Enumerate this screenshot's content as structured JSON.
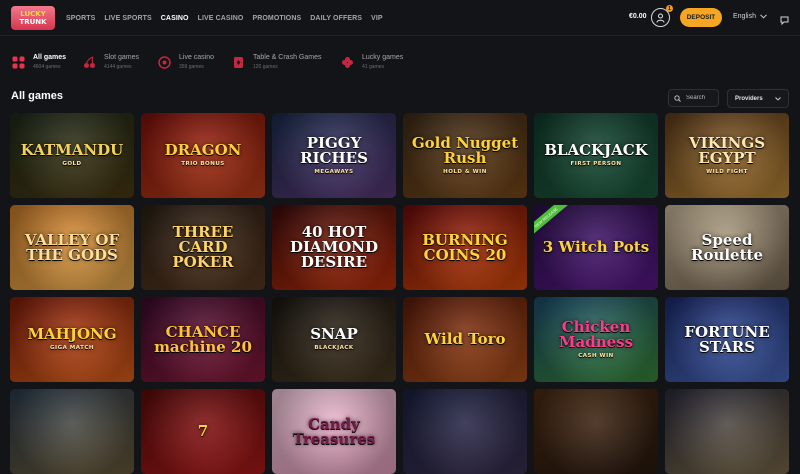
{
  "brand": {
    "line1": "LUCKY",
    "line2": "TRUNK"
  },
  "nav": [
    "SPORTS",
    "LIVE SPORTS",
    "CASINO",
    "LIVE CASINO",
    "PROMOTIONS",
    "DAILY OFFERS",
    "VIP"
  ],
  "nav_active": "CASINO",
  "header": {
    "balance": "€0.00",
    "notifications": "1",
    "deposit_label": "DEPOSIT",
    "language": "English"
  },
  "categories": [
    {
      "name": "All games",
      "count": "4604 games",
      "icon": "grid-icon",
      "active": true
    },
    {
      "name": "Slot games",
      "count": "4144 games",
      "icon": "cherry-icon",
      "active": false
    },
    {
      "name": "Live casino",
      "count": "359 games",
      "icon": "roulette-icon",
      "active": false
    },
    {
      "name": "Table & Crash Games",
      "count": "120 games",
      "icon": "cards-icon",
      "active": false
    },
    {
      "name": "Lucky games",
      "count": "41 games",
      "icon": "clover-icon",
      "active": false
    }
  ],
  "search": {
    "placeholder": "Search"
  },
  "providers": {
    "label": "Providers"
  },
  "section_title": "All games",
  "colors": {
    "accent": "#f5a623",
    "background": "#131417"
  },
  "games": [
    {
      "title": "KATMANDU",
      "subtitle": "GOLD",
      "bg1": "#1d2a1a",
      "bg2": "#4a3a12",
      "color": "#f2d25a"
    },
    {
      "title": "DRAGON",
      "subtitle": "TRIO BONUS",
      "bg1": "#7a0f0a",
      "bg2": "#c2401a",
      "color": "#ffcf3a"
    },
    {
      "title": "PIGGY RICHES",
      "subtitle": "MEGAWAYS",
      "bg1": "#1a2b4a",
      "bg2": "#5a3a7a",
      "color": "#ffffff"
    },
    {
      "title": "Gold Nugget Rush",
      "subtitle": "HOLD & WIN",
      "bg1": "#3a2a18",
      "bg2": "#7a4a1a",
      "color": "#ffd23a"
    },
    {
      "title": "BLACKJACK",
      "subtitle": "FIRST PERSON",
      "bg1": "#0f3a2a",
      "bg2": "#1d5a3e",
      "color": "#ffffff"
    },
    {
      "title": "VIKINGS EGYPT",
      "subtitle": "WILD FIGHT",
      "bg1": "#5a3a1a",
      "bg2": "#c08a3a",
      "color": "#ffe8b0"
    },
    {
      "title": "VALLEY OF THE GODS",
      "subtitle": "",
      "bg1": "#c87a2a",
      "bg2": "#f0b050",
      "color": "#ffe09a"
    },
    {
      "title": "THREE CARD POKER",
      "subtitle": "",
      "bg1": "#2a1e14",
      "bg2": "#5a3a20",
      "color": "#ffd36a"
    },
    {
      "title": "40 HOT DIAMOND DESIRE",
      "subtitle": "",
      "bg1": "#3a0a0a",
      "bg2": "#c0300a",
      "color": "#ffffff"
    },
    {
      "title": "BURNING COINS 20",
      "subtitle": "",
      "bg1": "#6a0a0a",
      "bg2": "#d84a0a",
      "color": "#ffd43a"
    },
    {
      "title": "3 Witch Pots",
      "subtitle": "",
      "bg1": "#2a0f4a",
      "bg2": "#5a1a8a",
      "color": "#ffd23a",
      "ribbon": "NEW RELEASE"
    },
    {
      "title": "Speed Roulette",
      "subtitle": "",
      "bg1": "#c8b89a",
      "bg2": "#7a6a55",
      "color": "#ffffff"
    },
    {
      "title": "MAHJONG",
      "subtitle": "GIGA MATCH",
      "bg1": "#7a1a0a",
      "bg2": "#e0601a",
      "color": "#ffd23a"
    },
    {
      "title": "CHANCE machine 20",
      "subtitle": "",
      "bg1": "#3a0a2a",
      "bg2": "#8a1a3a",
      "color": "#ffc23a"
    },
    {
      "title": "SNAP",
      "subtitle": "BLACKJACK",
      "bg1": "#1a1612",
      "bg2": "#4a3a22",
      "color": "#ffffff"
    },
    {
      "title": "Wild Toro",
      "subtitle": "",
      "bg1": "#5a1a0a",
      "bg2": "#b0501a",
      "color": "#ffd23a"
    },
    {
      "title": "Chicken Madness",
      "subtitle": "CASH WIN",
      "bg1": "#1a4a6a",
      "bg2": "#3a8a3a",
      "color": "#ff3a8a"
    },
    {
      "title": "FORTUNE STARS",
      "subtitle": "",
      "bg1": "#1a2a6a",
      "bg2": "#4a6ac0",
      "color": "#ffffff"
    },
    {
      "title": "",
      "subtitle": "",
      "bg1": "#2a3a4a",
      "bg2": "#6a5a3a",
      "color": "#ffffff"
    },
    {
      "title": "7",
      "subtitle": "",
      "bg1": "#5a0a0a",
      "bg2": "#b01a1a",
      "color": "#ffd23a"
    },
    {
      "title": "Candy Treasures",
      "subtitle": "",
      "bg1": "#f0c8d8",
      "bg2": "#e8a0c0",
      "color": "#7a1a4a"
    },
    {
      "title": "",
      "subtitle": "",
      "bg1": "#1a2040",
      "bg2": "#3a3050",
      "color": "#ffffff"
    },
    {
      "title": "",
      "subtitle": "",
      "bg1": "#4a2a12",
      "bg2": "#2a1a10",
      "color": "#ffd23a"
    },
    {
      "title": "",
      "subtitle": "",
      "bg1": "#2a2a3a",
      "bg2": "#7a6a4a",
      "color": "#ffffff"
    }
  ]
}
